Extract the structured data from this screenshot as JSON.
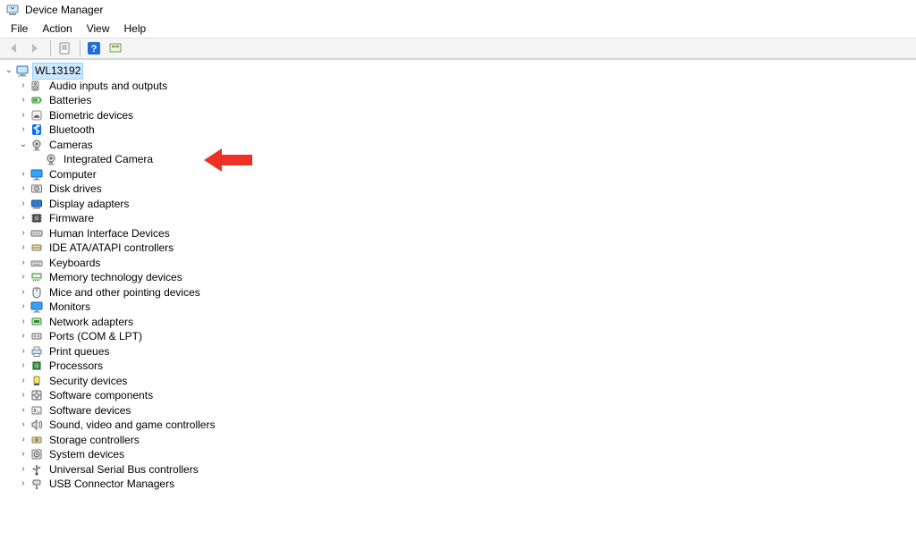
{
  "window": {
    "title": "Device Manager"
  },
  "menu": {
    "file": "File",
    "action": "Action",
    "view": "View",
    "help": "Help"
  },
  "root": {
    "name": "WL13192"
  },
  "categories": [
    {
      "id": "audio",
      "label": "Audio inputs and outputs"
    },
    {
      "id": "batteries",
      "label": "Batteries"
    },
    {
      "id": "biometric",
      "label": "Biometric devices"
    },
    {
      "id": "bluetooth",
      "label": "Bluetooth"
    },
    {
      "id": "cameras",
      "label": "Cameras",
      "expanded": true,
      "children": [
        {
          "id": "intcam",
          "label": "Integrated Camera"
        }
      ]
    },
    {
      "id": "computer",
      "label": "Computer"
    },
    {
      "id": "disk",
      "label": "Disk drives"
    },
    {
      "id": "display",
      "label": "Display adapters"
    },
    {
      "id": "firmware",
      "label": "Firmware"
    },
    {
      "id": "hid",
      "label": "Human Interface Devices"
    },
    {
      "id": "ide",
      "label": "IDE ATA/ATAPI controllers"
    },
    {
      "id": "keyboards",
      "label": "Keyboards"
    },
    {
      "id": "memtech",
      "label": "Memory technology devices"
    },
    {
      "id": "mice",
      "label": "Mice and other pointing devices"
    },
    {
      "id": "monitors",
      "label": "Monitors"
    },
    {
      "id": "network",
      "label": "Network adapters"
    },
    {
      "id": "ports",
      "label": "Ports (COM & LPT)"
    },
    {
      "id": "printq",
      "label": "Print queues"
    },
    {
      "id": "proc",
      "label": "Processors"
    },
    {
      "id": "security",
      "label": "Security devices"
    },
    {
      "id": "swcomp",
      "label": "Software components"
    },
    {
      "id": "swdev",
      "label": "Software devices"
    },
    {
      "id": "sound",
      "label": "Sound, video and game controllers"
    },
    {
      "id": "storage",
      "label": "Storage controllers"
    },
    {
      "id": "system",
      "label": "System devices"
    },
    {
      "id": "usb",
      "label": "Universal Serial Bus controllers"
    },
    {
      "id": "usbconn",
      "label": "USB Connector Managers"
    }
  ],
  "colors": {
    "select_bg": "#cce8ff",
    "select_border": "#99d1ff",
    "annotation": "#ed3124"
  },
  "icons": {
    "root": "computer-icon",
    "audio": "speaker-icon",
    "batteries": "battery-icon",
    "biometric": "fingerprint-icon",
    "bluetooth": "bluetooth-icon",
    "cameras": "camera-icon",
    "computer": "monitor-icon",
    "disk": "disk-icon",
    "display": "display-adapter-icon",
    "firmware": "chip-icon",
    "hid": "hid-icon",
    "ide": "ide-icon",
    "keyboards": "keyboard-icon",
    "memtech": "memory-icon",
    "mice": "mouse-icon",
    "monitors": "monitor-icon",
    "network": "network-adapter-icon",
    "ports": "port-icon",
    "printq": "printer-icon",
    "proc": "cpu-icon",
    "security": "security-icon",
    "swcomp": "software-component-icon",
    "swdev": "software-device-icon",
    "sound": "sound-icon",
    "storage": "storage-icon",
    "system": "system-icon",
    "usb": "usb-icon",
    "usbconn": "usb-connector-icon",
    "intcam": "camera-icon"
  }
}
